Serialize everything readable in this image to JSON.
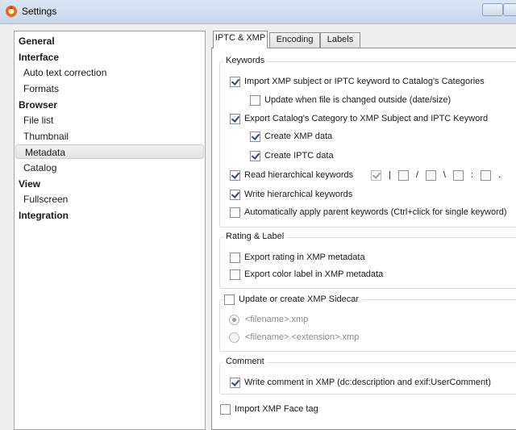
{
  "window": {
    "title": "Settings"
  },
  "tree": {
    "items": [
      {
        "label": "General",
        "kind": "category"
      },
      {
        "label": "Interface",
        "kind": "category"
      },
      {
        "label": "Auto text correction",
        "kind": "item"
      },
      {
        "label": "Formats",
        "kind": "item"
      },
      {
        "label": "Browser",
        "kind": "category"
      },
      {
        "label": "File list",
        "kind": "item"
      },
      {
        "label": "Thumbnail",
        "kind": "item"
      },
      {
        "label": "Metadata",
        "kind": "item",
        "selected": true
      },
      {
        "label": "Catalog",
        "kind": "item"
      },
      {
        "label": "View",
        "kind": "category"
      },
      {
        "label": "Fullscreen",
        "kind": "item"
      },
      {
        "label": "Integration",
        "kind": "category"
      }
    ]
  },
  "tabs": [
    {
      "label": "IPTC & XMP",
      "active": true
    },
    {
      "label": "Encoding",
      "active": false
    },
    {
      "label": "Labels",
      "active": false
    }
  ],
  "keywords": {
    "title": "Keywords",
    "import_xmp": {
      "label": "Import XMP subject or IPTC keyword to Catalog's Categories",
      "checked": true
    },
    "update_outside": {
      "label": "Update when file is changed outside (date/size)",
      "checked": false
    },
    "export_category": {
      "label": "Export Catalog's Category to XMP Subject and IPTC Keyword",
      "checked": true
    },
    "create_xmp": {
      "label": "Create XMP data",
      "checked": true
    },
    "create_iptc": {
      "label": "Create IPTC data",
      "checked": true
    },
    "read_hier": {
      "label": "Read hierarchical keywords",
      "checked": true
    },
    "separators": [
      {
        "symbol": "|",
        "checked": true
      },
      {
        "symbol": "/",
        "checked": false
      },
      {
        "symbol": "\\",
        "checked": false
      },
      {
        "symbol": ":",
        "checked": false
      },
      {
        "symbol": ".",
        "checked": false
      }
    ],
    "write_hier": {
      "label": "Write hierarchical keywords",
      "checked": true
    },
    "auto_parent": {
      "label": "Automatically apply parent keywords (Ctrl+click for single keyword)",
      "checked": false
    }
  },
  "rating": {
    "title": "Rating & Label",
    "export_rating": {
      "label": "Export rating in XMP metadata",
      "checked": false
    },
    "export_color": {
      "label": "Export color label in XMP metadata",
      "checked": false
    }
  },
  "sidecar": {
    "title": "Update or create XMP Sidecar",
    "checked": false,
    "option1": {
      "label": "<filename>.xmp",
      "selected": true
    },
    "option2": {
      "label": "<filename>.<extension>.xmp",
      "selected": false
    }
  },
  "comment": {
    "title": "Comment",
    "write_comment": {
      "label": "Write comment in XMP (dc:description and exif:UserComment)",
      "checked": true
    }
  },
  "face_tag": {
    "label": "Import XMP Face tag",
    "checked": false
  }
}
